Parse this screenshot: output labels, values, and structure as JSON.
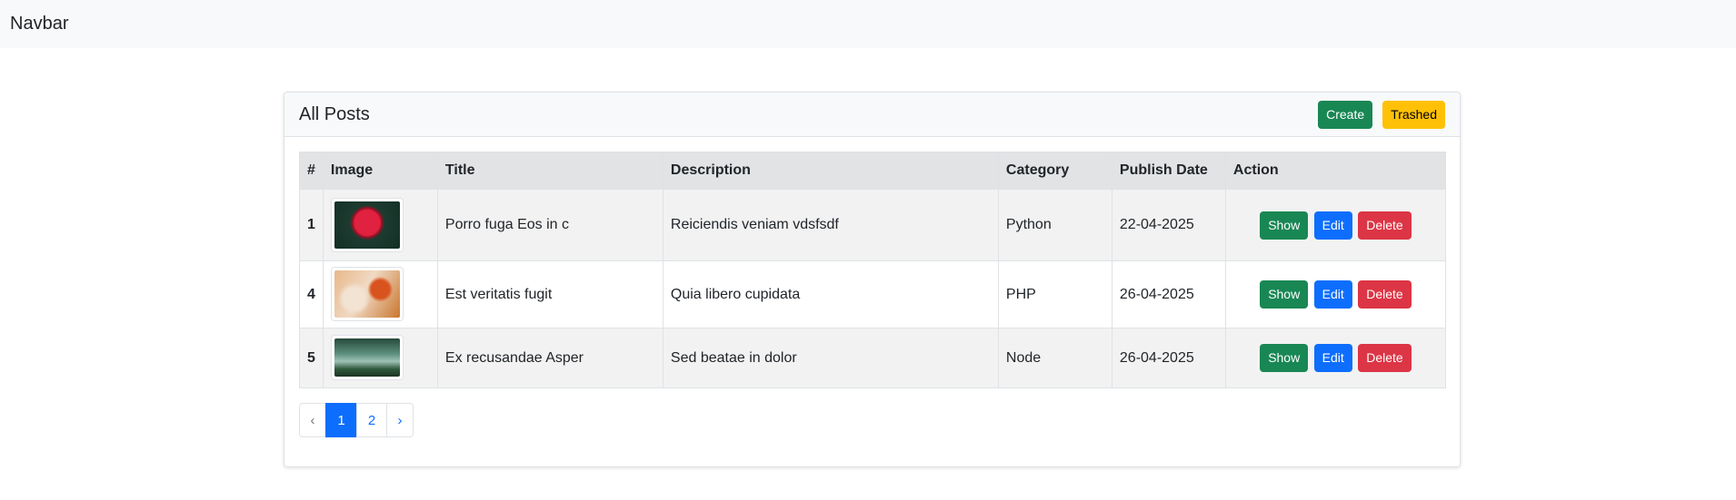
{
  "navbar": {
    "brand": "Navbar"
  },
  "card": {
    "title": "All Posts",
    "create_label": "Create",
    "trashed_label": "Trashed"
  },
  "table": {
    "headers": [
      "#",
      "Image",
      "Title",
      "Description",
      "Category",
      "Publish Date",
      "Action"
    ],
    "rows": [
      {
        "id": "1",
        "image": "red-flower-photo",
        "title": "Porro fuga Eos in c",
        "description": "Reiciendis veniam vdsfsdf",
        "category": "Python",
        "date": "22-04-2025"
      },
      {
        "id": "4",
        "image": "autumn-leaves-photo",
        "title": "Est veritatis fugit",
        "description": "Quia libero cupidata",
        "category": "PHP",
        "date": "26-04-2025"
      },
      {
        "id": "5",
        "image": "forest-lake-photo",
        "title": "Ex recusandae Asper",
        "description": "Sed beatae in dolor",
        "category": "Node",
        "date": "26-04-2025"
      }
    ],
    "actions": {
      "show": "Show",
      "edit": "Edit",
      "delete": "Delete"
    }
  },
  "pagination": {
    "prev": "‹",
    "pages": [
      "1",
      "2"
    ],
    "active": "1",
    "next": "›"
  },
  "colors": {
    "success": "#198754",
    "warning": "#ffc107",
    "primary": "#0d6efd",
    "danger": "#dc3545"
  }
}
